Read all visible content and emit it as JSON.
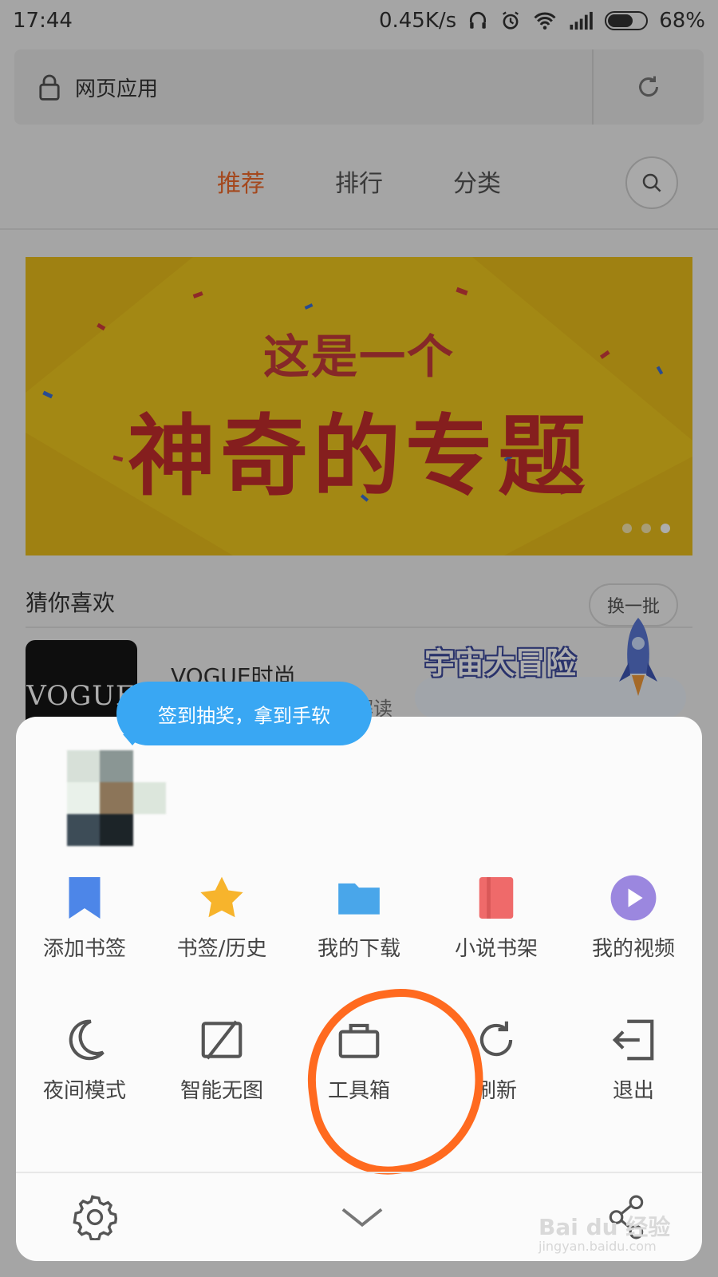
{
  "status_bar": {
    "time": "17:44",
    "network_speed": "0.45K/s",
    "battery": "68%",
    "icons": [
      "headset-icon",
      "alarm-icon",
      "wifi-icon",
      "signal-icon",
      "battery-icon"
    ]
  },
  "address_bar": {
    "text": "网页应用",
    "lock_icon": "lock-icon",
    "refresh_icon": "refresh-icon"
  },
  "tabs": [
    {
      "label": "推荐",
      "active": true
    },
    {
      "label": "排行",
      "active": false
    },
    {
      "label": "分类",
      "active": false
    }
  ],
  "banner": {
    "line1": "这是一个",
    "line2": "神奇的专题",
    "dots": 3,
    "active_dot": 2
  },
  "section": {
    "title": "猜你喜欢",
    "refresh_button": "换一批"
  },
  "app_card": {
    "icon_text": "VOGUE",
    "name": "VOGUE时尚",
    "desc": "势解读"
  },
  "promo": {
    "title": "宇宙大冒险"
  },
  "tooltip": {
    "text": "签到抽奖，拿到手软"
  },
  "menu": {
    "row1": [
      {
        "label": "添加书签",
        "icon": "bookmark-icon"
      },
      {
        "label": "书签/历史",
        "icon": "star-icon"
      },
      {
        "label": "我的下载",
        "icon": "folder-icon"
      },
      {
        "label": "小说书架",
        "icon": "book-icon"
      },
      {
        "label": "我的视频",
        "icon": "play-icon"
      }
    ],
    "row2": [
      {
        "label": "夜间模式",
        "icon": "moon-icon"
      },
      {
        "label": "智能无图",
        "icon": "no-image-icon"
      },
      {
        "label": "工具箱",
        "icon": "toolbox-icon"
      },
      {
        "label": "刷新",
        "icon": "refresh-icon"
      },
      {
        "label": "退出",
        "icon": "exit-icon"
      }
    ]
  },
  "bottom_bar": {
    "settings_icon": "gear-icon",
    "collapse_icon": "chevron-down-icon",
    "share_icon": "share-icon"
  },
  "watermark": {
    "text": "Bai du 经验",
    "url": "jingyan.baidu.com"
  },
  "colors": {
    "accent": "#f26a2b",
    "tooltip": "#39a7f3",
    "banner_bg": "#f1c91e",
    "banner_text": "#c52d2d",
    "annotation": "#ff6a1f"
  }
}
